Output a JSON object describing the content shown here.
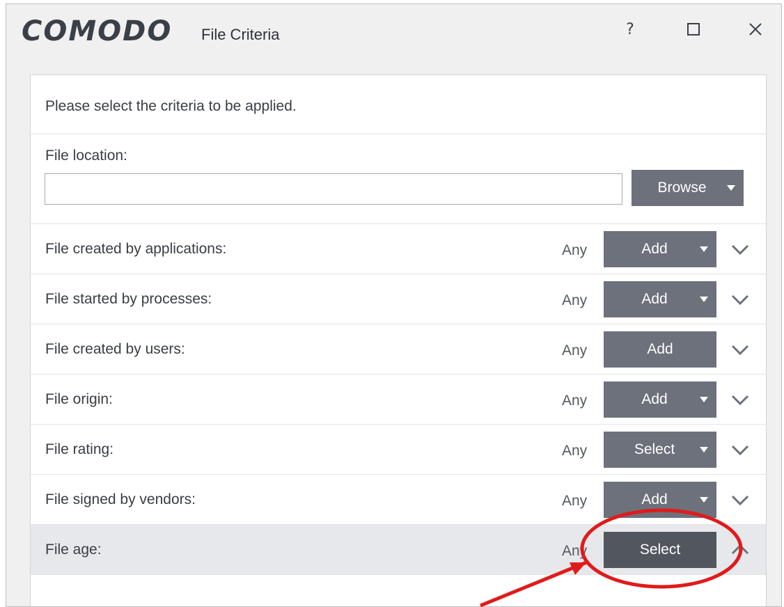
{
  "window": {
    "brand": "COMODO",
    "title": "File Criteria",
    "help_glyph": "?",
    "maximize_icon": "maximize-icon",
    "close_icon": "close-icon"
  },
  "panel": {
    "instruction": "Please select the criteria to be applied.",
    "file_location": {
      "label": "File location:",
      "value": "",
      "placeholder": "",
      "browse_label": "Browse"
    },
    "criteria": [
      {
        "label": "File created by applications:",
        "value": "Any",
        "button": "Add",
        "has_dropdown": true,
        "expanded": false
      },
      {
        "label": "File started by processes:",
        "value": "Any",
        "button": "Add",
        "has_dropdown": true,
        "expanded": false
      },
      {
        "label": "File created by users:",
        "value": "Any",
        "button": "Add",
        "has_dropdown": false,
        "expanded": false
      },
      {
        "label": "File origin:",
        "value": "Any",
        "button": "Add",
        "has_dropdown": true,
        "expanded": false
      },
      {
        "label": "File rating:",
        "value": "Any",
        "button": "Select",
        "has_dropdown": true,
        "expanded": false
      },
      {
        "label": "File signed by vendors:",
        "value": "Any",
        "button": "Add",
        "has_dropdown": true,
        "expanded": false
      },
      {
        "label": "File age:",
        "value": "Any",
        "button": "Select",
        "has_dropdown": false,
        "expanded": true
      }
    ]
  },
  "colors": {
    "button_bg": "#6c717c",
    "button_active_bg": "#52565f",
    "active_row_bg": "#e6e8ec",
    "annotation_red": "#e01b1b"
  }
}
